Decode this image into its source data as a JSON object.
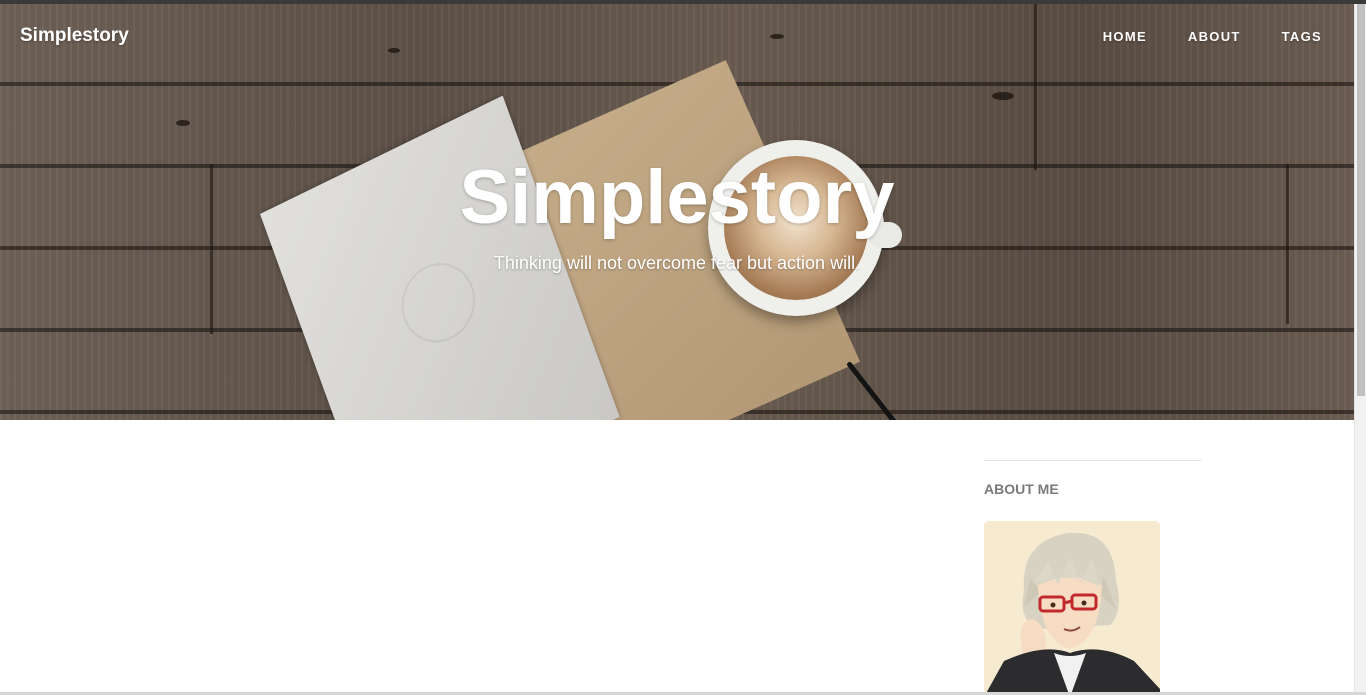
{
  "navbar": {
    "brand": "Simplestory",
    "links": [
      "HOME",
      "ABOUT",
      "TAGS"
    ]
  },
  "hero": {
    "title": "Simplestory",
    "subtitle": "Thinking will not overcome fear but action will."
  },
  "sidebar": {
    "about_heading": "ABOUT ME"
  },
  "colors": {
    "nav_text": "#ffffff",
    "sidebar_heading": "#7a7a7a",
    "avatar_bg": "#f6ead0"
  }
}
